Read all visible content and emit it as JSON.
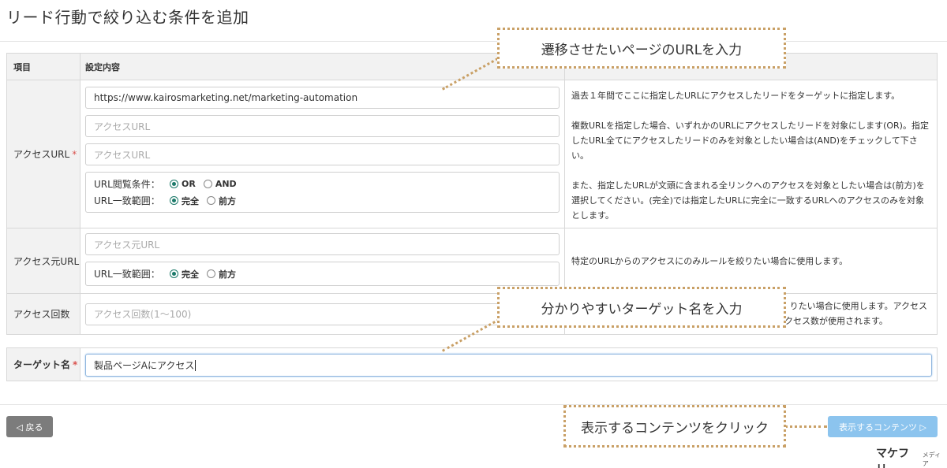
{
  "page": {
    "title": "リード行動で絞り込む条件を追加"
  },
  "table": {
    "headers": {
      "item": "項目",
      "settings": "設定内容"
    },
    "access_url": {
      "label": "アクセスURL",
      "required_mark": "*",
      "inputs": [
        {
          "value": "https://www.kairosmarketing.net/marketing-automation",
          "placeholder": "アクセスURL"
        },
        {
          "value": "",
          "placeholder": "アクセスURL"
        },
        {
          "value": "",
          "placeholder": "アクセスURL"
        }
      ],
      "condition_label": "URL閲覧条件：",
      "condition_options": [
        "OR",
        "AND"
      ],
      "condition_selected": "OR",
      "match_label": "URL一致範囲：",
      "match_options": [
        "完全",
        "前方"
      ],
      "match_selected": "完全",
      "desc1": "過去１年間でここに指定したURLにアクセスしたリードをターゲットに指定します。",
      "desc2": "複数URLを指定した場合、いずれかのURLにアクセスしたリードを対象にします(OR)。指定したURL全てにアクセスしたリードのみを対象としたい場合は(AND)をチェックして下さい。",
      "desc3": "また、指定したURLが文頭に含まれる全リンクへのアクセスを対象としたい場合は(前方)を選択してください。(完全)では指定したURLに完全に一致するURLへのアクセスのみを対象とします。"
    },
    "referrer_url": {
      "label": "アクセス元URL",
      "placeholder": "アクセス元URL",
      "match_label": "URL一致範囲：",
      "match_options": [
        "完全",
        "前方"
      ],
      "match_selected": "完全",
      "desc": "特定のURLからのアクセスにのみルールを絞りたい場合に使用します。"
    },
    "access_count": {
      "label": "アクセス回数",
      "placeholder": "アクセス回数(1〜100)",
      "desc_line1": "りたい場合に使用します。アクセス",
      "desc_line2": "クセス数が使用されます。"
    }
  },
  "target": {
    "label": "ターゲット名",
    "required_mark": "*",
    "value": "製品ページAにアクセス"
  },
  "buttons": {
    "back": "◁ 戻る",
    "next": "表示するコンテンツ ▷"
  },
  "callouts": {
    "url": "遷移させたいページのURLを入力",
    "target": "分かりやすいターゲット名を入力",
    "content": "表示するコンテンツをクリック"
  },
  "brand": {
    "main": "マケフリ",
    "sub": "メディア"
  },
  "colors": {
    "callout_border": "#c9a066",
    "radio_on": "#1c7a6a",
    "next_button": "#8cc4ee",
    "back_button": "#7c7c7c"
  }
}
